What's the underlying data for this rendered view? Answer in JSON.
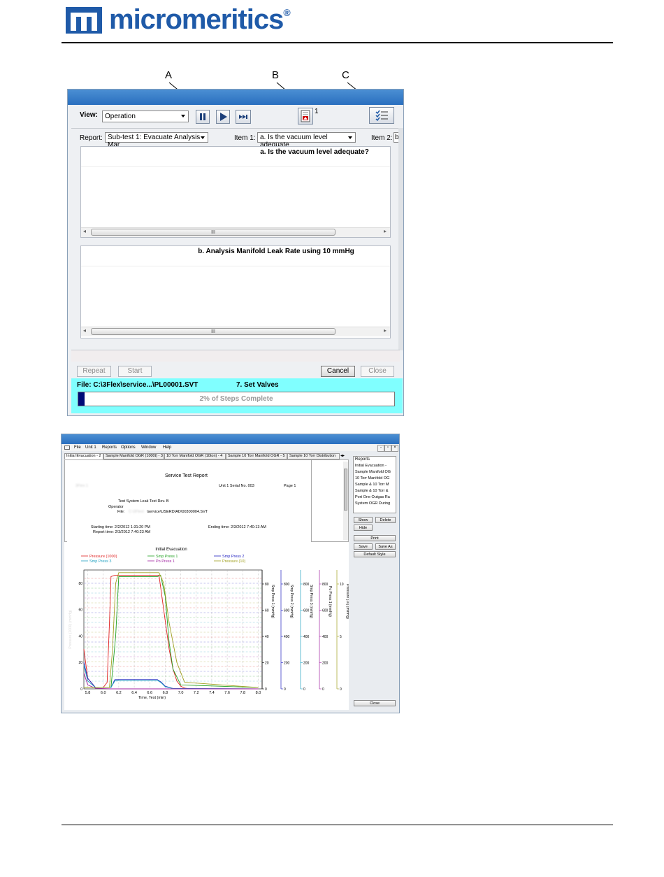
{
  "brand": {
    "name": "micromeritics",
    "registered": "®",
    "color": "#1f5aa8"
  },
  "callouts": {
    "a": "A",
    "b": "B",
    "c": "C"
  },
  "window1": {
    "view_label": "View:",
    "view_value": "Operation",
    "pause_icon": "pause-icon",
    "play_icon": "play-icon",
    "skip_icon": "skip-forward-icon",
    "report_icon_count": "1",
    "report_label": "Report:",
    "report_value": "Sub-test 1: Evacuate Analysis Mar",
    "item1_label": "Item 1:",
    "item1_value": "a. Is the vacuum level adequate",
    "item2_label": "Item 2:",
    "item2_value": "b",
    "pane1_title": "a. Is the vacuum level adequate?",
    "pane2_title": "b. Analysis Manifold Leak Rate using 10 mmHg",
    "thumb_grip": "III",
    "buttons": {
      "repeat": "Repeat",
      "start": "Start",
      "cancel": "Cancel",
      "close": "Close"
    },
    "file_label": "File:  C:\\3Flex\\service...\\PL00001.SVT",
    "step_label": "7. Set Valves",
    "progress_text": "2% of Steps Complete",
    "progress_percent": 2
  },
  "window2": {
    "menu": [
      "File",
      "Unit 1",
      "Reports",
      "Options",
      "Window",
      "Help"
    ],
    "tabs": [
      "Initial Evacuation - 2",
      "Sample Manifold OGR (1000t) - 3",
      "10 Torr Manifold OGR (10ton) - 4",
      "Sample  10 Torr Manifold OGR - 5",
      "Sample  10 Torr Distribution"
    ],
    "report": {
      "title": "Service Test Report",
      "blurred_name": "3Flex 1",
      "unit_serial": "Unit 1  Serial No. 003",
      "page": "Page 1",
      "test": "Test  System Leak Test Rev. B",
      "operator": "Operator",
      "file_prefix": "File:",
      "file_blur": "C:\\3Flex\\",
      "file_path": "\\service\\USERDIAD\\00300004.SVT",
      "starting_time": "Starting time:  2/2/2012 1:31:20 PM",
      "ending_time": "Ending time:  2/3/2012 7:40:13 AM",
      "report_time": "Report time:  2/3/2012 7:40:23 AM"
    },
    "reports_panel": {
      "header": "Reports",
      "items": [
        "Initial Evacuation -",
        "Sample Manifold OG",
        "10 Torr Manifold OG",
        "Sample & 10 Torr M",
        "Sample & 10 Torr &",
        "Port One Outgas Ra",
        "System OGR During"
      ],
      "buttons": {
        "show": "Show",
        "delete": "Delete",
        "hide": "Hide",
        "print": "Print",
        "save": "Save",
        "save_as": "Save As",
        "default_style": "Default Style",
        "close": "Close"
      }
    }
  },
  "chart_data": {
    "type": "line",
    "title": "Initial Evacuation",
    "xlabel": "Time, Test (min)",
    "xlim": [
      5.75,
      8.05
    ],
    "x_ticks": [
      "5.8",
      "6.0",
      "6.2",
      "6.4",
      "6.6",
      "6.8",
      "7.0",
      "7.2",
      "7.4",
      "7.6",
      "7.8",
      "8.0"
    ],
    "series": [
      {
        "name": "Pressure (1000)",
        "color": "#e02020",
        "x": [
          5.75,
          5.8,
          5.9,
          6.0,
          6.05,
          6.08,
          6.1,
          6.15,
          6.2,
          6.6,
          6.72,
          6.78,
          6.85,
          6.9,
          6.95,
          7.0,
          7.05,
          7.1,
          7.2,
          8.0
        ],
        "y": [
          30,
          8,
          1,
          1,
          5,
          50,
          85,
          86,
          86,
          86,
          86,
          60,
          30,
          15,
          6,
          2,
          0.6,
          0.2,
          0,
          0
        ]
      },
      {
        "name": "Smp Press 1",
        "color": "#20a020",
        "x": [
          5.75,
          6.1,
          6.16,
          6.2,
          6.7,
          6.74,
          6.8,
          6.85,
          6.9,
          7.0,
          8.0
        ],
        "y": [
          1,
          1,
          40,
          85,
          85,
          86,
          70,
          35,
          15,
          3,
          1
        ]
      },
      {
        "name": "Smp Press 2",
        "color": "#2020c0",
        "x": [
          5.75,
          5.8,
          5.9,
          6.1,
          6.15,
          6.2,
          6.7,
          6.75,
          6.8,
          6.9,
          8.0
        ],
        "y": [
          20,
          8,
          1,
          1,
          7,
          7,
          7,
          5,
          2,
          0.3,
          0
        ]
      },
      {
        "name": "Smp Press 3",
        "color": "#20a0c0",
        "x": [
          5.75,
          5.8,
          5.9,
          6.1,
          6.15,
          6.2,
          6.7,
          6.75,
          6.8,
          6.9,
          8.0
        ],
        "y": [
          18,
          6,
          1,
          1,
          6,
          6.5,
          6.5,
          4.5,
          1.6,
          0.2,
          0
        ]
      },
      {
        "name": "Po Press 1",
        "color": "#a020a0",
        "x": [
          5.75,
          5.8,
          5.9,
          6.0,
          6.1,
          8.0
        ],
        "y": [
          12,
          3,
          0.5,
          0.2,
          0,
          0
        ]
      },
      {
        "name": "Pressure (10)",
        "color": "#a0a020",
        "x": [
          5.75,
          6.08,
          6.12,
          6.16,
          6.2,
          6.72,
          6.78,
          6.85,
          6.95,
          7.05,
          8.0
        ],
        "y": [
          1,
          1,
          30,
          80,
          88,
          88,
          80,
          50,
          20,
          5,
          1
        ]
      }
    ],
    "axes": [
      {
        "label": "Pressure (1000) (mmHg)",
        "side": "left",
        "ticks": [
          "0",
          "20",
          "40",
          "60",
          "80"
        ]
      },
      {
        "label": "Smp Press 1 (mmHg)",
        "side": "right",
        "ticks": [
          "0",
          "20",
          "40",
          "60",
          "80"
        ]
      },
      {
        "label": "Smp Press 2 (mmHg)",
        "side": "right",
        "ticks": [
          "0",
          "200",
          "400",
          "600",
          "800"
        ]
      },
      {
        "label": "Smp Press 3 (mmHg)",
        "side": "right",
        "ticks": [
          "0",
          "200",
          "400",
          "600",
          "800"
        ]
      },
      {
        "label": "Po Press 1 (mmHg)",
        "side": "right",
        "ticks": [
          "0",
          "200",
          "400",
          "600",
          "800"
        ]
      },
      {
        "label": "Pressure (10) (mmHg)",
        "side": "right",
        "ticks": [
          "0",
          "5",
          "10"
        ]
      }
    ],
    "legend": "top",
    "grid": true
  }
}
